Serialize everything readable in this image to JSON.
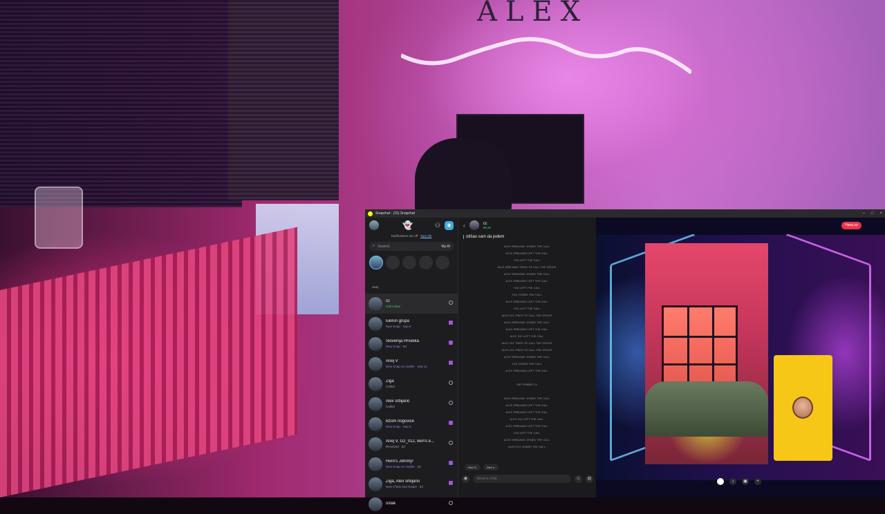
{
  "titlebar": {
    "title": "Snapchat - (15) Snapchat"
  },
  "background": {
    "wall_text": "ALEX"
  },
  "notifications": {
    "text": "Notifications are off",
    "action": "Turn On"
  },
  "search": {
    "placeholder": "Search",
    "myai": "My AI"
  },
  "stories": {
    "me_label": "Anej"
  },
  "chats": [
    {
      "name": "cc",
      "sub": "Call Active",
      "status": "green"
    },
    {
      "name": "lukinin grupa",
      "sub": "New Snap · Sep 6",
      "status": "purple"
    },
    {
      "name": "Slovenija Hrvaška",
      "sub": "New Snap · 5d",
      "status": "purple"
    },
    {
      "name": "Anej V",
      "sub": "New Snap on mobile · Sep 14",
      "status": "purple"
    },
    {
      "name": "Žiga",
      "sub": "Called",
      "status": "grey"
    },
    {
      "name": "Alex srbijano",
      "sub": "Called",
      "status": "grey"
    },
    {
      "name": "Bžom nogovice",
      "sub": "New Snap · Sep 8",
      "status": "purple"
    },
    {
      "name": "Anej V, G2_012, Ben's e...",
      "sub": "Received · 2d",
      "status": "grey"
    },
    {
      "name": "Hero's Johnny!",
      "sub": "New Snap on mobile · 4d",
      "status": "purple"
    },
    {
      "name": "Žiga, Alex srbijano",
      "sub": "New Chats and Snaps · 6d",
      "status": "purple"
    },
    {
      "name": "ostak",
      "sub": "",
      "status": "grey"
    }
  ],
  "conversation": {
    "name": "cc",
    "time": "05:19",
    "last_message": "otišao sam da jedem",
    "log": [
      "ALEX SRBIJANO JOINED THE CALL",
      "ALEX SRBIJANO LEFT THE CALL",
      "YOU LEFT THE CALL",
      "ALEX SRBIJANO TRIED TO CALL THE GROUP",
      "ALEX SRBIJANO JOINED THE CALL",
      "ALEX SRBIJANO LEFT THE CALL",
      "YOU LEFT THE CALL",
      "YOU JOINED THE CALL",
      "ALEX SRBIJANO LEFT THE CALL",
      "YOU LEFT THE CALL",
      "ALEX G11 TRIED TO CALL THE GROUP",
      "ALEX SRBIJANO JOINED THE CALL",
      "ALEX SRBIJANO LEFT THE CALL",
      "ALEX G11 LEFT THE CALL",
      "ALEX G11 TRIED TO CALL THE GROUP",
      "ALEX G11 TRIED TO CALL THE GROUP",
      "ALEX SRBIJANO JOINED THE CALL",
      "YOU JOINED THE CALL",
      "ALEX SRBIJANO LEFT THE CALL",
      "",
      "SEPTEMBER 24",
      "",
      "ALEX SRBIJANO JOINED THE CALL",
      "ALEX SRBIJANO LEFT THE CALL",
      "ALEX SRBIJANO LEFT THE CALL",
      "ALEX G11 LEFT THE CALL",
      "ALEX SRBIJANO LEFT THE CALL",
      "YOU LEFT THE CALL",
      "ALEX SRBIJANO JOINED THE CALL",
      "ALEX G11 JOINED THE CALL",
      "ALEX SRBIJANO LEFT THE CALL"
    ],
    "chips": [
      "Alex G.",
      "Alex s."
    ],
    "composer_placeholder": "Send a chat"
  },
  "call": {
    "hangup_label": "Hang up"
  },
  "colors": {
    "accent_green": "#45d17a",
    "hangup_red": "#f0314a",
    "snap_yellow": "#fffc00",
    "camera_blue": "#3fa9e0"
  }
}
